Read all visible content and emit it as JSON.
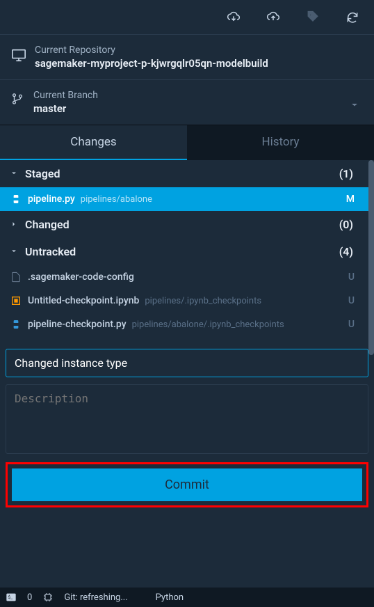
{
  "toolbar": {
    "icons": [
      "cloud-download",
      "cloud-upload",
      "tag",
      "refresh"
    ]
  },
  "repository": {
    "label": "Current Repository",
    "name": "sagemaker-myproject-p-kjwrgqlr05qn-modelbuild"
  },
  "branch": {
    "label": "Current Branch",
    "name": "master"
  },
  "tabs": {
    "changes": "Changes",
    "history": "History"
  },
  "sections": {
    "staged": {
      "label": "Staged",
      "count": "(1)"
    },
    "changed": {
      "label": "Changed",
      "count": "(0)"
    },
    "untracked": {
      "label": "Untracked",
      "count": "(4)"
    }
  },
  "staged_files": [
    {
      "name": "pipeline.py",
      "path": "pipelines/abalone",
      "status": "M"
    }
  ],
  "untracked_files": [
    {
      "name": ".sagemaker-code-config",
      "path": "",
      "status": "U"
    },
    {
      "name": "Untitled-checkpoint.ipynb",
      "path": "pipelines/.ipynb_checkpoints",
      "status": "U"
    },
    {
      "name": "pipeline-checkpoint.py",
      "path": "pipelines/abalone/.ipynb_checkpoints",
      "status": "U"
    }
  ],
  "commit": {
    "summary": "Changed instance type",
    "description_placeholder": "Description",
    "button": "Commit"
  },
  "statusbar": {
    "count": "0",
    "git": "Git: refreshing...",
    "language": "Python"
  }
}
